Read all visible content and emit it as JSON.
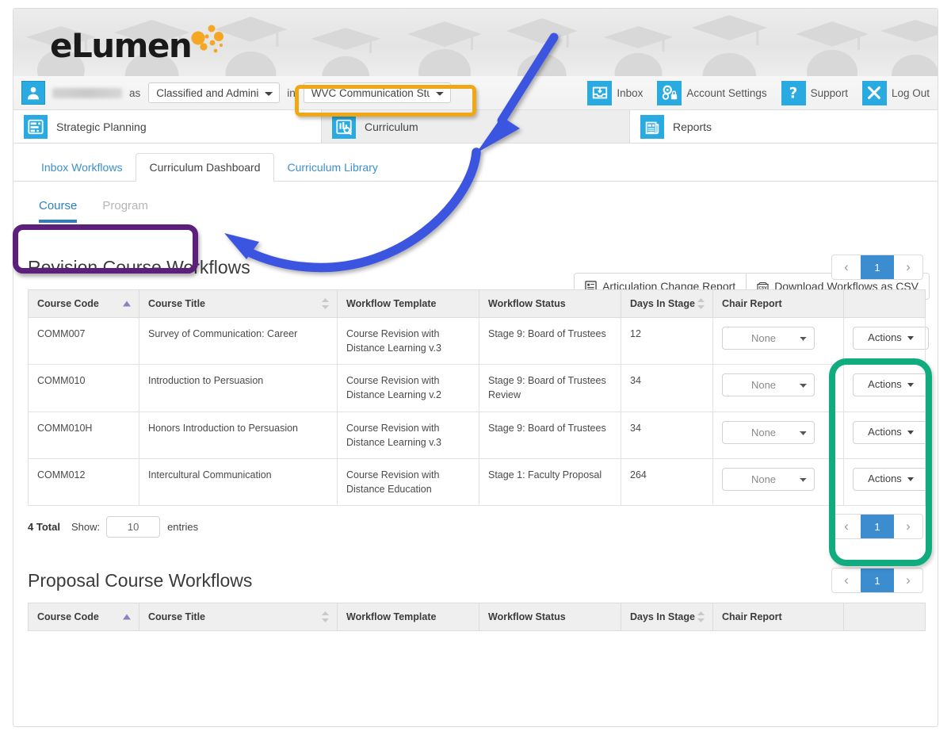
{
  "brand": {
    "logo_text": "eLumen"
  },
  "userbar": {
    "as_label": "as",
    "in_label": "in",
    "role_value": "Classified and Adminis",
    "org_value": "WVC Communication Studi",
    "nav": [
      {
        "label": "Inbox",
        "icon": "inbox-icon"
      },
      {
        "label": "Account Settings",
        "icon": "gears-lock-icon"
      },
      {
        "label": "Support",
        "icon": "question-mark-icon"
      },
      {
        "label": "Log Out",
        "icon": "close-x-icon"
      }
    ]
  },
  "modules": [
    {
      "label": "Strategic Planning",
      "icon": "strategic-planning-icon",
      "active": false
    },
    {
      "label": "Curriculum",
      "icon": "curriculum-icon",
      "active": true
    },
    {
      "label": "Reports",
      "icon": "reports-icon",
      "active": false
    }
  ],
  "subtabs": [
    {
      "label": "Inbox Workflows",
      "active": false
    },
    {
      "label": "Curriculum Dashboard",
      "active": true
    },
    {
      "label": "Curriculum Library",
      "active": false
    }
  ],
  "scope_tabs": [
    {
      "label": "Course",
      "active": true
    },
    {
      "label": "Program",
      "active": false
    }
  ],
  "report_buttons": [
    {
      "label": "Articulation Change Report",
      "icon": "report-list-icon"
    },
    {
      "label": "Download Workflows as CSV",
      "icon": "csv-file-icon"
    }
  ],
  "columns": [
    {
      "label": "Course Code",
      "sort": "asc"
    },
    {
      "label": "Course Title",
      "sort": "both"
    },
    {
      "label": "Workflow Template",
      "sort": "none"
    },
    {
      "label": "Workflow Status",
      "sort": "none"
    },
    {
      "label": "Days In Stage",
      "sort": "both"
    },
    {
      "label": "Chair Report",
      "sort": "none"
    },
    {
      "label": "",
      "sort": "none"
    }
  ],
  "revision_section": {
    "title": "Revision Course Workflows",
    "pagination": {
      "prev": "‹",
      "page": "1",
      "next": "›"
    },
    "rows": [
      {
        "course_code": "COMM007",
        "course_title": "Survey of Communication: Career",
        "workflow_template": "Course Revision with Distance Learning v.3",
        "workflow_status": "Stage 9: Board of Trustees",
        "days_in_stage": "12",
        "chair_report": "None",
        "actions": "Actions"
      },
      {
        "course_code": "COMM010",
        "course_title": "Introduction to Persuasion",
        "workflow_template": "Course Revision with Distance Learning v.2",
        "workflow_status": "Stage 9: Board of Trustees Review",
        "days_in_stage": "34",
        "chair_report": "None",
        "actions": "Actions"
      },
      {
        "course_code": "COMM010H",
        "course_title": "Honors Introduction to Persuasion",
        "workflow_template": "Course Revision with Distance Learning v.3",
        "workflow_status": "Stage 9: Board of Trustees",
        "days_in_stage": "34",
        "chair_report": "None",
        "actions": "Actions"
      },
      {
        "course_code": "COMM012",
        "course_title": "Intercultural Communication",
        "workflow_template": "Course Revision with Distance Education",
        "workflow_status": "Stage 1: Faculty Proposal",
        "days_in_stage": "264",
        "chair_report": "None",
        "actions": "Actions"
      }
    ],
    "footer": {
      "total": "4 Total",
      "show_label": "Show:",
      "show_value": "10",
      "entries_label": "entries"
    }
  },
  "proposal_section": {
    "title": "Proposal Course Workflows",
    "pagination": {
      "prev": "‹",
      "page": "1",
      "next": "›"
    }
  },
  "colors": {
    "brand_blue": "#29abe2",
    "accent_orange": "#f5a623",
    "annotation_orange": "#efa716",
    "annotation_purple": "#5c1f7a",
    "annotation_teal": "#10ab7f",
    "annotation_blue": "#3b55e0",
    "page_active_blue": "#3b8dd0",
    "link_blue": "#3a8fd0"
  }
}
